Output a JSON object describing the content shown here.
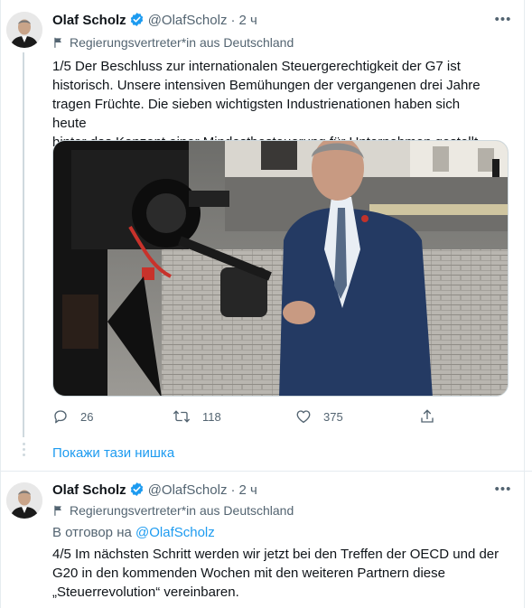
{
  "tweets": [
    {
      "name": "Olaf Scholz",
      "handle": "@OlafScholz",
      "separator": "·",
      "time": "2 ч",
      "label": "Regierungsvertreter*in aus Deutschland",
      "text_lines": [
        "1/5 Der Beschluss zur internationalen Steuergerechtigkeit der G7 ist",
        "historisch. Unsere intensiven Bemühungen der vergangenen drei Jahre",
        "tragen Früchte. Die sieben wichtigsten Industrienationen haben sich heute",
        "hinter das Konzept einer Mindestbesteuerung für Unternehmen gestellt."
      ],
      "replies": "26",
      "retweets": "118",
      "likes": "375"
    },
    {
      "name": "Olaf Scholz",
      "handle": "@OlafScholz",
      "separator": "·",
      "time": "2 ч",
      "label": "Regierungsvertreter*in aus Deutschland",
      "reply_prefix": "В отговор на",
      "reply_mention": "@OlafScholz",
      "text_lines": [
        "4/5 Im nächsten Schritt werden wir jetzt bei den Treffen der OECD und der",
        "G20 in den kommenden Wochen mit den weiteren Partnern diese",
        "„Steuerrevolution“ vereinbaren."
      ]
    }
  ],
  "show_thread": "Покажи тази нишка",
  "colors": {
    "accent": "#1d9bf0",
    "secondary_text": "#536471",
    "border": "#e6ecf0"
  }
}
